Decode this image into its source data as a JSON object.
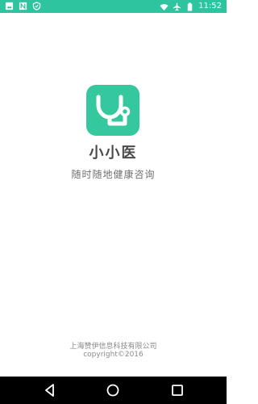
{
  "status_bar": {
    "time": "11:52",
    "background_color": "#2ec4a0",
    "left_icons": [
      "image-notification-icon",
      "n-notification-icon",
      "shield-notification-icon"
    ],
    "right_icons": [
      "wifi-icon",
      "airplane-mode-icon",
      "battery-icon"
    ]
  },
  "splash": {
    "logo_icon": "stethoscope-icon",
    "logo_color": "#35c79d",
    "app_name": "小小医",
    "tagline": "随时随地健康咨询"
  },
  "footer": {
    "company": "上海赞伊信息科技有限公司",
    "copyright": "copyright©2016"
  },
  "nav_bar": {
    "buttons": [
      "back-icon",
      "home-icon",
      "recents-icon"
    ]
  }
}
